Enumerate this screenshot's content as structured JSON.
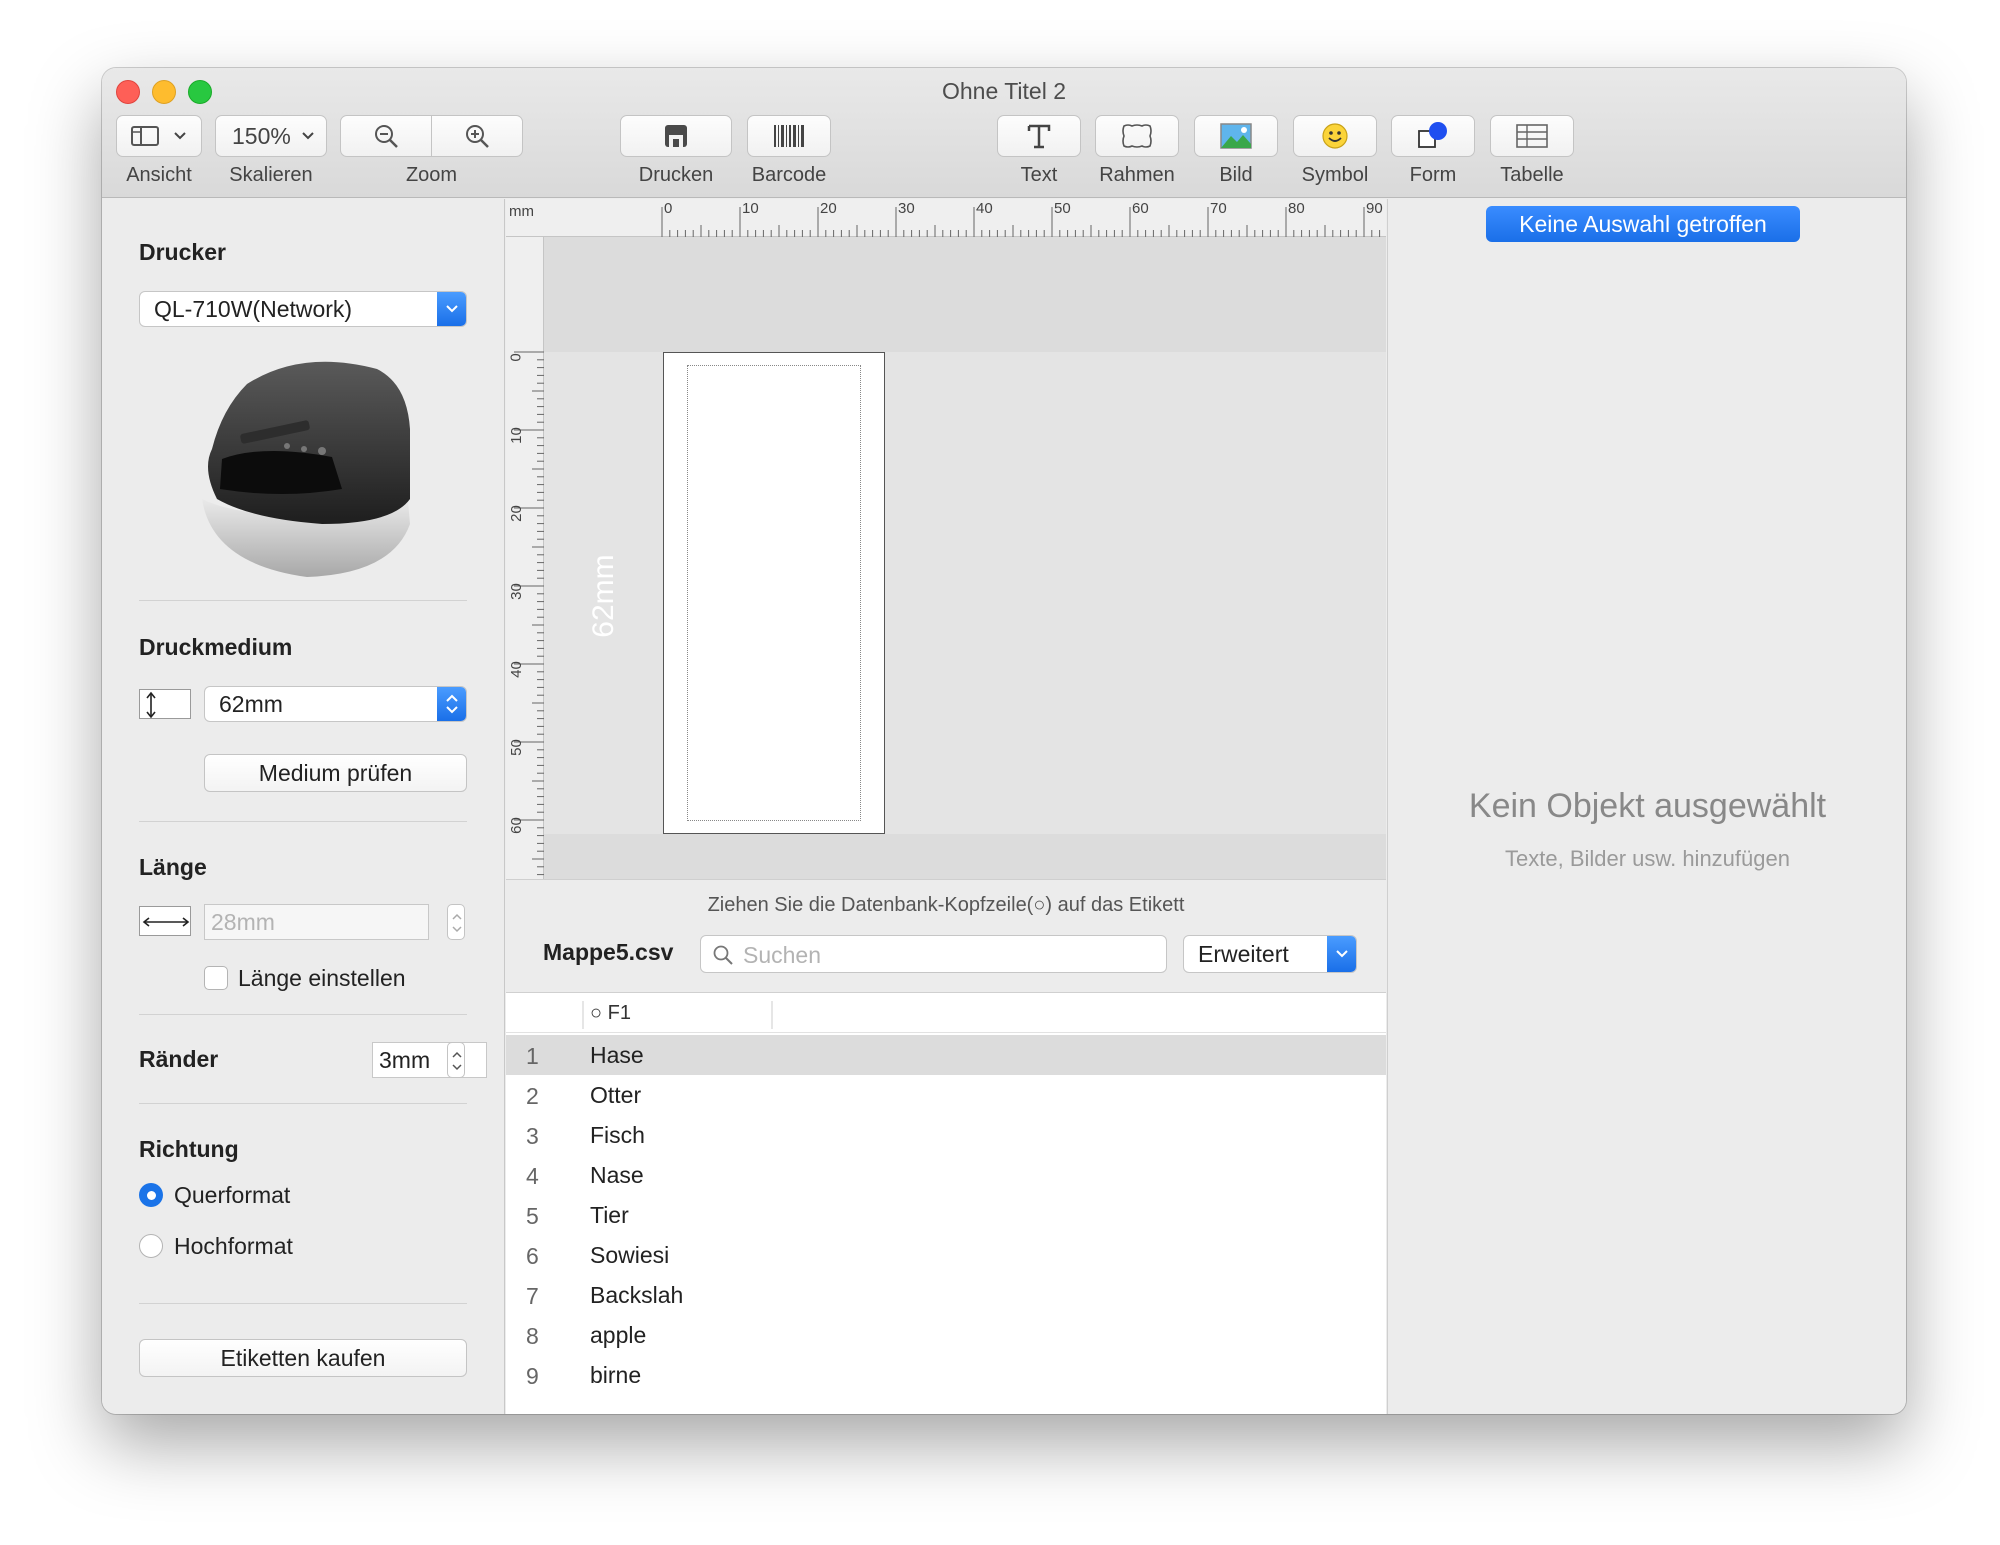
{
  "window": {
    "title": "Ohne Titel 2"
  },
  "toolbar": {
    "view": "Ansicht",
    "scale_value": "150%",
    "scale": "Skalieren",
    "zoom": "Zoom",
    "print": "Drucken",
    "barcode": "Barcode",
    "text": "Text",
    "frame": "Rahmen",
    "image": "Bild",
    "symbol": "Symbol",
    "shape": "Form",
    "table": "Tabelle",
    "icons": [
      "sidebar-view-icon",
      "zoom-out-icon",
      "zoom-in-icon",
      "printer-icon",
      "barcode-icon",
      "text-icon",
      "frame-icon",
      "image-icon",
      "smiley-icon",
      "shape-icon",
      "table-icon"
    ]
  },
  "sidebar": {
    "printer_title": "Drucker",
    "printer_value": "QL-710W(Network)",
    "media_title": "Druckmedium",
    "media_value": "62mm",
    "check_media": "Medium prüfen",
    "length_title": "Länge",
    "length_placeholder": "28mm",
    "set_length": "Länge einstellen",
    "margins_title": "Ränder",
    "margins_value": "3mm",
    "direction_title": "Richtung",
    "landscape": "Querformat",
    "portrait": "Hochformat",
    "buy_labels": "Etiketten kaufen"
  },
  "canvas": {
    "unit": "mm",
    "top_ticks": [
      "0",
      "10",
      "20",
      "30",
      "40",
      "50",
      "60",
      "70",
      "80",
      "90"
    ],
    "left_ticks": [
      "0",
      "10",
      "20",
      "30",
      "40",
      "50",
      "60"
    ],
    "label_height": "62mm"
  },
  "database": {
    "hint": "Ziehen Sie die Datenbank-Kopfzeile(○) auf das Etikett",
    "file": "Mappe5.csv",
    "search_placeholder": "Suchen",
    "mode": "Erweitert",
    "column": "○ F1",
    "rows": [
      {
        "n": "1",
        "v": "Hase"
      },
      {
        "n": "2",
        "v": "Otter"
      },
      {
        "n": "3",
        "v": "Fisch"
      },
      {
        "n": "4",
        "v": "Nase"
      },
      {
        "n": "5",
        "v": "Tier"
      },
      {
        "n": "6",
        "v": "Sowiesi"
      },
      {
        "n": "7",
        "v": "Backslah"
      },
      {
        "n": "8",
        "v": "apple"
      },
      {
        "n": "9",
        "v": "birne"
      }
    ]
  },
  "inspector": {
    "selection": "Keine Auswahl getroffen",
    "empty_title": "Kein Objekt ausgewählt",
    "empty_sub": "Texte, Bilder usw. hinzufügen"
  },
  "colors": {
    "accent": "#1a73e8",
    "selected_row": "#dcdcdc"
  }
}
